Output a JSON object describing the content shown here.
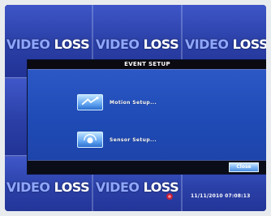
{
  "camera_tiles": [
    {
      "label_video": "VIDEO",
      "label_loss": "LOSS"
    },
    {
      "label_video": "VIDEO",
      "label_loss": "LOSS"
    },
    {
      "label_video": "VIDEO",
      "label_loss": "LOSS"
    },
    {
      "label_video": "VIDEO",
      "label_loss": "LOSS"
    },
    {
      "label_video": "VIDEO",
      "label_loss": "LOSS"
    }
  ],
  "dialog": {
    "title": "EVENT SETUP",
    "items": [
      {
        "label": "Motion Setup...",
        "icon": "motion-setup-icon"
      },
      {
        "label": "Sensor Setup...",
        "icon": "sensor-setup-icon"
      }
    ],
    "close_label": "Close"
  },
  "status": {
    "timestamp": "11/11/2010 07:08:13",
    "record_icon": "record-indicator-icon"
  },
  "colors": {
    "screen_bg": "#2b3f9f",
    "dialog_bg": "#1f4bb6",
    "title_bar": "#0a0a10",
    "button": "#7fb7f4"
  }
}
